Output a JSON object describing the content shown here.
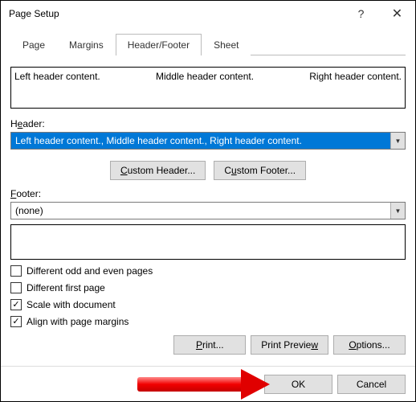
{
  "titlebar": {
    "title": "Page Setup"
  },
  "tabs": [
    {
      "label": "Page"
    },
    {
      "label": "Margins"
    },
    {
      "label": "Header/Footer"
    },
    {
      "label": "Sheet"
    }
  ],
  "preview": {
    "left": "Left header content.",
    "center": "Middle header content.",
    "right": "Right header content."
  },
  "header": {
    "label": "Header:",
    "value": "Left header content., Middle header content., Right header content."
  },
  "customHeaderBtn": "Custom Header...",
  "customFooterBtn": "Custom Footer...",
  "footer": {
    "label": "Footer:",
    "value": "(none)"
  },
  "checkboxes": {
    "diffOddEven": {
      "label": "Different odd and even pages",
      "checked": false
    },
    "diffFirst": {
      "label": "Different first page",
      "checked": false
    },
    "scale": {
      "label": "Scale with document",
      "checked": true
    },
    "align": {
      "label": "Align with page margins",
      "checked": true
    }
  },
  "actions": {
    "print": "Print...",
    "printPreview": "Print Preview",
    "options": "Options..."
  },
  "dialog": {
    "ok": "OK",
    "cancel": "Cancel"
  }
}
